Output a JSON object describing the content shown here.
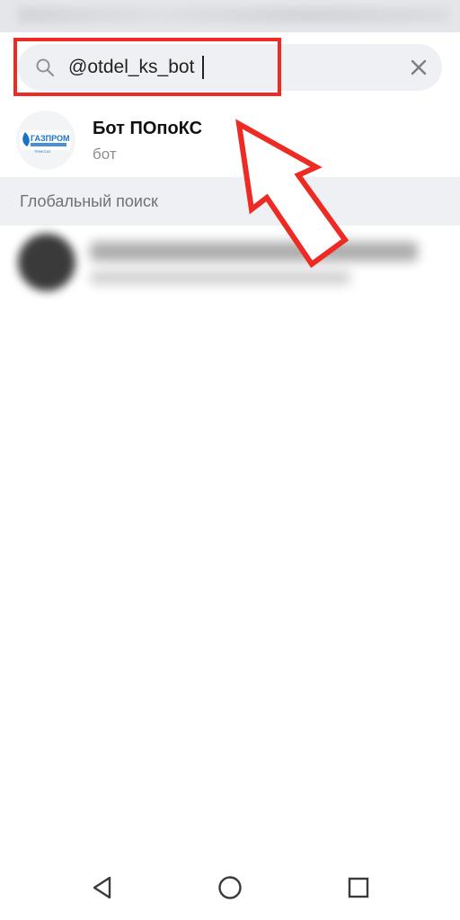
{
  "search": {
    "query": "@otdel_ks_bot"
  },
  "results": [
    {
      "title": "Бот ПОпоКС",
      "subtitle": "бот",
      "avatar_logo_text": "ГАЗПРОМ"
    }
  ],
  "sections": {
    "global_search": "Глобальный поиск"
  },
  "icons": {
    "search": "search-icon",
    "clear": "close-icon",
    "back": "triangle-back-icon",
    "home": "circle-home-icon",
    "recents": "square-recents-icon"
  },
  "colors": {
    "annotation_red": "#ee2a24",
    "brand_blue": "#1a73c8"
  }
}
